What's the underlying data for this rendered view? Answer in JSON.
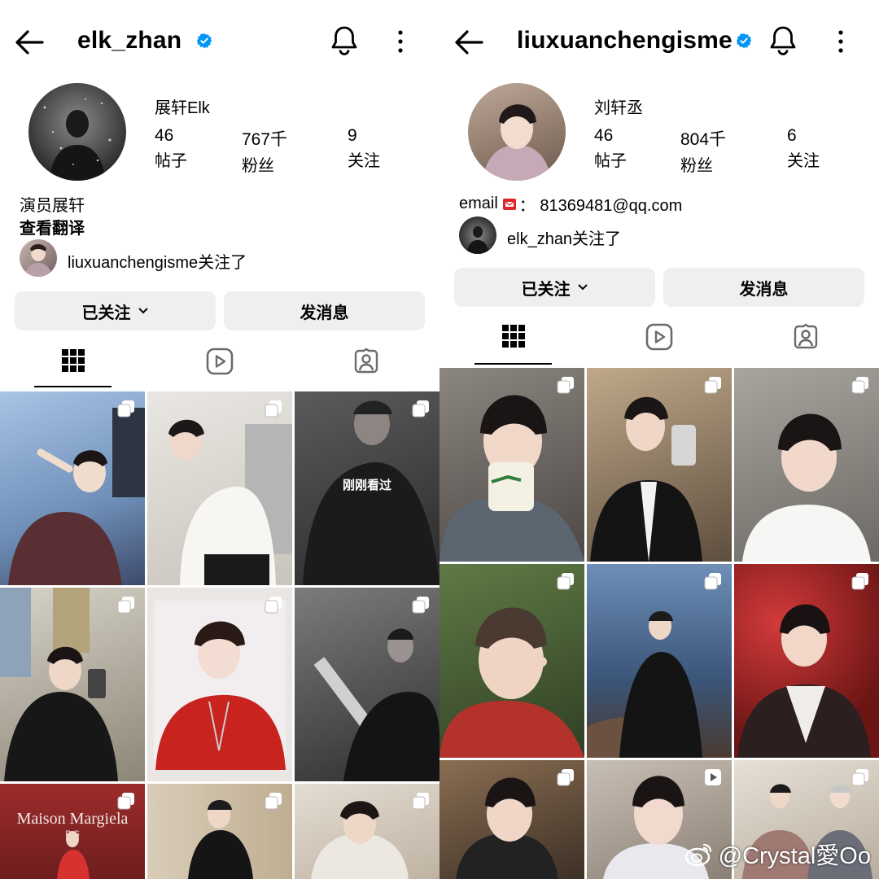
{
  "left": {
    "username": "elk_zhan",
    "display_name": "展轩Elk",
    "stats": [
      {
        "value": "46",
        "label": "帖子"
      },
      {
        "value": "767千",
        "label": "粉丝"
      },
      {
        "value": "9",
        "label": "关注"
      }
    ],
    "bio": "演员展轩",
    "translate": "查看翻译",
    "followed_by": "liuxuanchengisme关注了",
    "following_button": "已关注",
    "message_button": "发消息",
    "grid_overlay": "刚刚看过",
    "brand": "Maison Margiela",
    "brand_sub": "P    S"
  },
  "right": {
    "username": "liuxuanchengisme",
    "display_name": "刘轩丞",
    "stats": [
      {
        "value": "46",
        "label": "帖子"
      },
      {
        "value": "804千",
        "label": "粉丝"
      },
      {
        "value": "6",
        "label": "关注"
      }
    ],
    "email_label": "email",
    "email_rest": "：  81369481@qq.com",
    "followed_by": "elk_zhan关注了",
    "following_button": "已关注",
    "message_button": "发消息"
  },
  "watermark": "@Crystal愛Oo",
  "colors": {
    "verified": "#0095f6",
    "button_bg": "#efefef"
  }
}
